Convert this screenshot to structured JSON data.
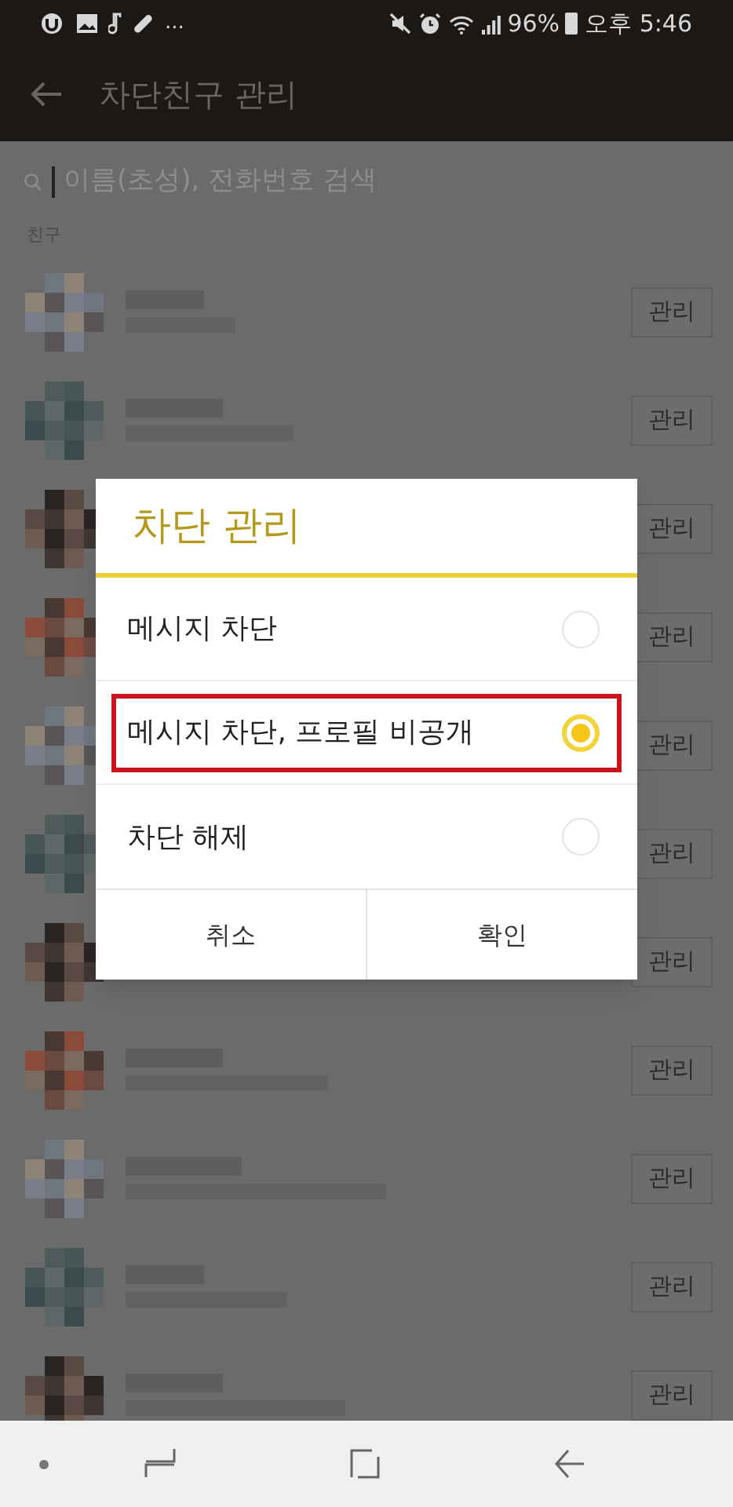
{
  "status_bar": {
    "notification_more": "...",
    "battery": "96%",
    "time": "오후 5:46"
  },
  "app_bar": {
    "title": "차단친구 관리"
  },
  "search": {
    "placeholder": "이름(초성), 전화번호 검색"
  },
  "section": {
    "label": "친구"
  },
  "friends": [
    {
      "button": "관리"
    },
    {
      "button": "관리"
    },
    {
      "button": "관리"
    },
    {
      "button": "관리"
    },
    {
      "button": "관리"
    },
    {
      "button": "관리"
    },
    {
      "button": "관리"
    },
    {
      "button": "관리"
    },
    {
      "button": "관리"
    },
    {
      "button": "관리"
    },
    {
      "button": "관리"
    }
  ],
  "dialog": {
    "title": "차단 관리",
    "options": [
      {
        "label": "메시지 차단",
        "selected": false,
        "highlighted": false
      },
      {
        "label": "메시지 차단, 프로필 비공개",
        "selected": true,
        "highlighted": true
      },
      {
        "label": "차단 해제",
        "selected": false,
        "highlighted": false
      }
    ],
    "buttons": [
      "취소",
      "확인"
    ]
  }
}
